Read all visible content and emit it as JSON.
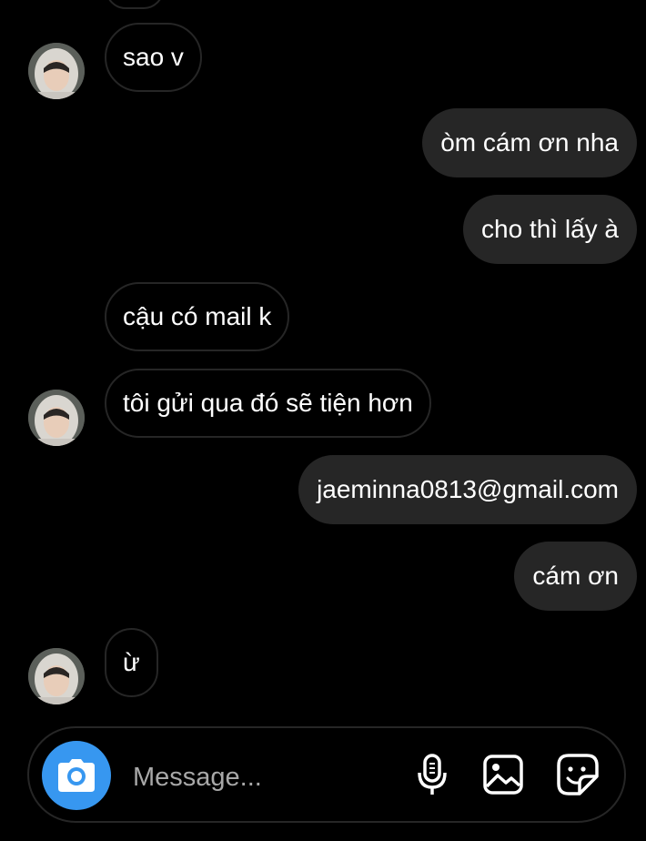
{
  "messages": [
    {
      "from": "them",
      "text": "sao v"
    },
    {
      "from": "me",
      "text": "òm cám ơn nha"
    },
    {
      "from": "me",
      "text": "cho thì lấy à"
    },
    {
      "from": "them",
      "text": "cậu có mail k"
    },
    {
      "from": "them",
      "text": "tôi gửi qua đó sẽ tiện hơn"
    },
    {
      "from": "me",
      "text": "jaeminna0813@gmail.com"
    },
    {
      "from": "me",
      "text": "cám ơn"
    },
    {
      "from": "them",
      "text": "ừ"
    }
  ],
  "composer": {
    "placeholder": "Message...",
    "icons": [
      "camera-icon",
      "microphone-icon",
      "gallery-icon",
      "sticker-icon"
    ],
    "accent_color": "#3797f0"
  },
  "colors": {
    "background": "#000000",
    "outgoing_bubble": "#262626",
    "incoming_border": "#262626",
    "placeholder_text": "#a8a8a8"
  }
}
